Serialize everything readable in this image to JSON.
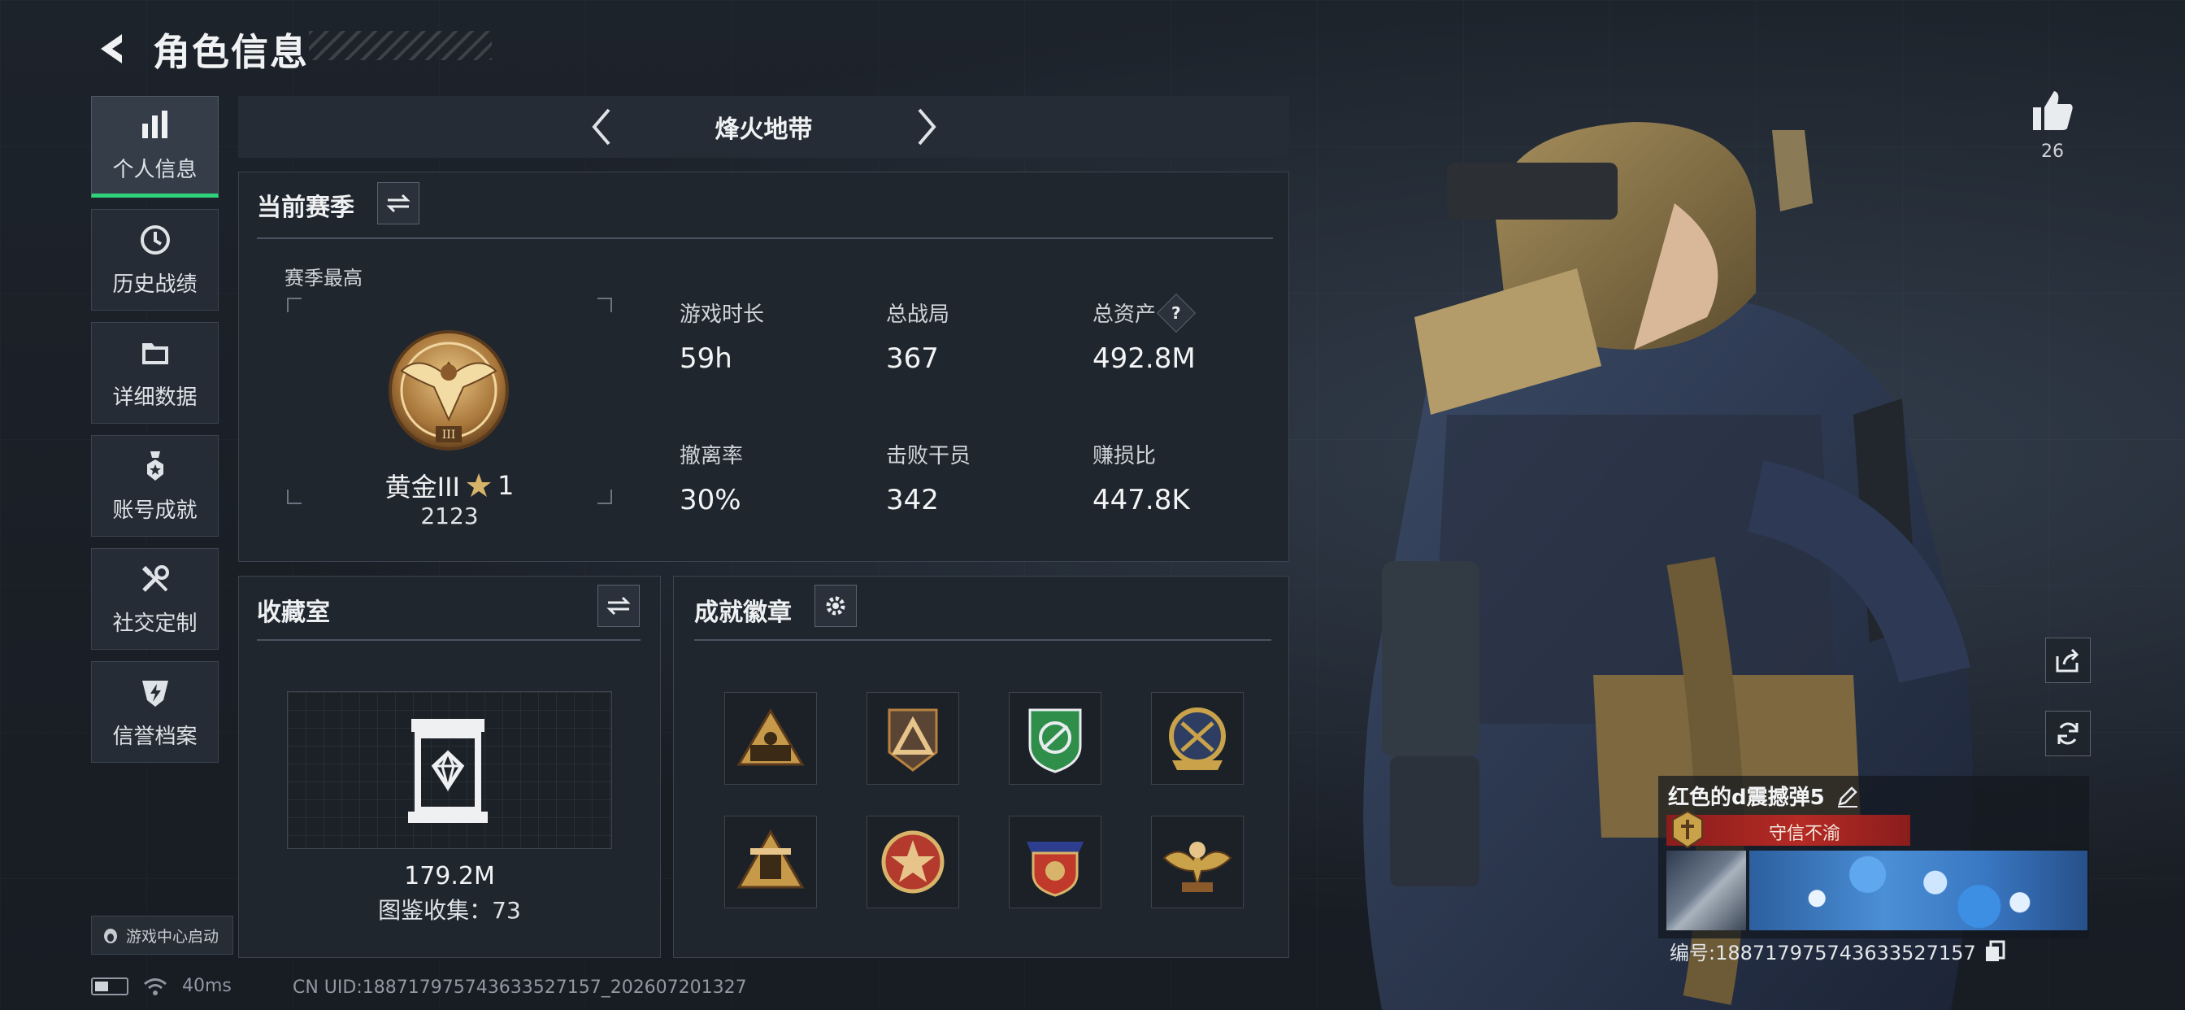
{
  "header": {
    "title": "角色信息"
  },
  "sidebar": {
    "items": [
      {
        "label": "个人信息",
        "icon": "bar-chart-icon",
        "active": true
      },
      {
        "label": "历史战绩",
        "icon": "history-clock-icon"
      },
      {
        "label": "详细数据",
        "icon": "folder-icon"
      },
      {
        "label": "账号成就",
        "icon": "medal-star-icon"
      },
      {
        "label": "社交定制",
        "icon": "wrench-tools-icon"
      },
      {
        "label": "信誉档案",
        "icon": "shield-lightning-icon"
      }
    ],
    "game_center": "游戏中心启动"
  },
  "mode_selector": {
    "current": "烽火地带"
  },
  "season_panel": {
    "title": "当前赛季",
    "season_high_label": "赛季最高",
    "rank": {
      "name": "黄金III",
      "stars": "1",
      "points": "2123"
    },
    "stats": [
      {
        "label": "游戏时长",
        "value": "59h"
      },
      {
        "label": "总战局",
        "value": "367"
      },
      {
        "label": "总资产",
        "value": "492.8M",
        "help": "?"
      },
      {
        "label": "撤离率",
        "value": "30%"
      },
      {
        "label": "击败干员",
        "value": "342"
      },
      {
        "label": "赚损比",
        "value": "447.8K"
      }
    ]
  },
  "collection_panel": {
    "title": "收藏室",
    "value": "179.2M",
    "catalog_label": "图鉴收集：73"
  },
  "badges_panel": {
    "title": "成就徽章",
    "badges": [
      {
        "icon": "triangle-soldiers-badge-icon",
        "color": "#c79a4a"
      },
      {
        "icon": "triangle-pyramid-badge-icon",
        "color": "#b8813f"
      },
      {
        "icon": "green-shield-badge-icon",
        "color": "#2f8f4a"
      },
      {
        "icon": "blue-gold-shield-badge-icon",
        "color": "#c9a24a"
      },
      {
        "icon": "gold-tower-badge-icon",
        "color": "#c79a4a"
      },
      {
        "icon": "red-star-badge-icon",
        "color": "#b33a2c"
      },
      {
        "icon": "red-blue-crest-badge-icon",
        "color": "#c0392b"
      },
      {
        "icon": "winged-skull-badge-icon",
        "color": "#c9a24a"
      }
    ]
  },
  "profile": {
    "likes": "26",
    "player_name": "红色的d震撼弹5",
    "honor_title": "守信不渝",
    "uid_label": "编号:1887179757436335271​57"
  },
  "status_bar": {
    "ping": "40ms",
    "uid_line": "CN UID:188717975743633527157_202607201327"
  },
  "colors": {
    "accent_green": "#2fd37b",
    "title_red": "#b52a25",
    "panel_bg": "#20262e"
  }
}
